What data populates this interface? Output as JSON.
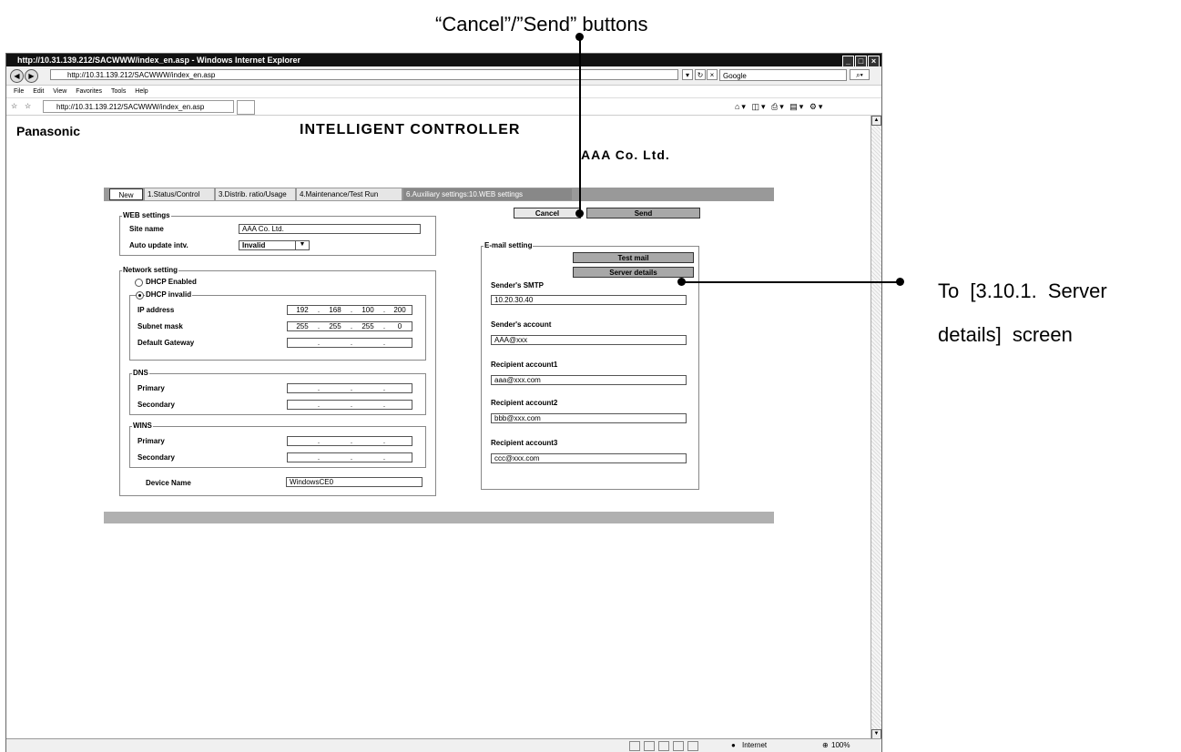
{
  "annotations": {
    "top": "“Cancel”/”Send” buttons",
    "right_line1": "To [3.10.1. Server",
    "right_line2": "details] screen"
  },
  "browser": {
    "title": "http://10.31.139.212/SACWWW/index_en.asp - Windows Internet Explorer",
    "address": "http://10.31.139.212/SACWWW/index_en.asp",
    "search_placeholder": "Google",
    "menu": [
      "File",
      "Edit",
      "View",
      "Favorites",
      "Tools",
      "Help"
    ],
    "tab_title": "http://10.31.139.212/SACWWW/index_en.asp",
    "status_zone": "Internet",
    "zoom": "100%"
  },
  "page": {
    "logo": "Panasonic",
    "title": "INTELLIGENT CONTROLLER",
    "site_title": "AAA Co. Ltd.",
    "tabs": [
      "New",
      "1.Status/Control",
      "3.Distrib. ratio/Usage",
      "4.Maintenance/Test Run",
      "6.Auxiliary settings:10.WEB settings"
    ]
  },
  "web_settings": {
    "legend": "WEB settings",
    "site_name_label": "Site name",
    "site_name_value": "AAA Co. Ltd.",
    "auto_update_label": "Auto update intv.",
    "auto_update_value": "Invalid"
  },
  "network": {
    "legend": "Network setting",
    "dhcp_enabled": "DHCP Enabled",
    "dhcp_invalid": "DHCP invalid",
    "ip_label": "IP address",
    "ip": [
      "192",
      "168",
      "100",
      "200"
    ],
    "mask_label": "Subnet mask",
    "mask": [
      "255",
      "255",
      "255",
      "0"
    ],
    "gateway_label": "Default Gateway",
    "dns_legend": "DNS",
    "dns_primary": "Primary",
    "dns_secondary": "Secondary",
    "wins_legend": "WINS",
    "wins_primary": "Primary",
    "wins_secondary": "Secondary",
    "device_name_label": "Device Name",
    "device_name_value": "WindowsCE0"
  },
  "actions": {
    "cancel": "Cancel",
    "send": "Send"
  },
  "email": {
    "legend": "E-mail setting",
    "test_mail": "Test mail",
    "server_details": "Server details",
    "smtp_label": "Sender's SMTP",
    "smtp_value": "10.20.30.40",
    "account_label": "Sender's account",
    "account_value": "AAA@xxx",
    "r1_label": "Recipient account1",
    "r1_value": "aaa@xxx.com",
    "r2_label": "Recipient account2",
    "r2_value": "bbb@xxx.com",
    "r3_label": "Recipient account3",
    "r3_value": "ccc@xxx.com"
  }
}
